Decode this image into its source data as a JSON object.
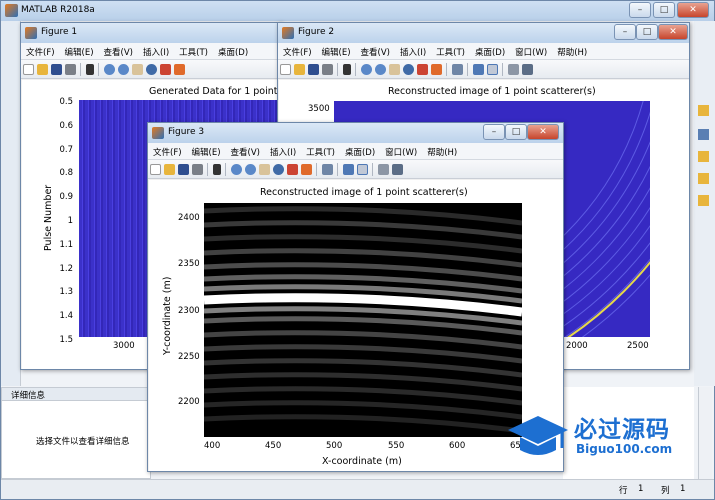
{
  "main_window": {
    "title": "MATLAB R2018a",
    "details_header": "详细信息",
    "details_text": "选择文件以查看详细信息",
    "status": {
      "row_label": "行",
      "row_value": "1",
      "col_label": "列",
      "col_value": "1"
    }
  },
  "menus": [
    "文件(F)",
    "编辑(E)",
    "查看(V)",
    "插入(I)",
    "工具(T)",
    "桌面(D)",
    "窗口(W)",
    "帮助(H)"
  ],
  "figure1": {
    "title": "Figure 1",
    "axes_title": "Generated Data for 1 point",
    "ylabel": "Pulse Number",
    "yticks": [
      "0.5",
      "0.6",
      "0.7",
      "0.8",
      "0.9",
      "1",
      "1.1",
      "1.2",
      "1.3",
      "1.4",
      "1.5"
    ],
    "xticks": [
      "3000"
    ]
  },
  "figure2": {
    "title": "Figure 2",
    "axes_title": "Reconstructed image of 1 point scatterer(s)",
    "yticks": [
      "3500"
    ],
    "xticks": [
      "2000",
      "2500"
    ]
  },
  "figure3": {
    "title": "Figure 3",
    "axes_title": "Reconstructed image of 1 point scatterer(s)",
    "ylabel": "Y-coordinate (m)",
    "xlabel": "X-coordinate (m)",
    "yticks": [
      "2400",
      "2350",
      "2300",
      "2250",
      "2200"
    ],
    "xticks": [
      "400",
      "450",
      "500",
      "550",
      "600",
      "65"
    ]
  },
  "watermark": {
    "brand_cn": "必过源码",
    "brand_url": "Biguo100.com"
  },
  "colors": {
    "matlab_blue_image": "#3a2fc8",
    "titlebar": "#c3d7ee",
    "close_red": "#c7452c"
  }
}
